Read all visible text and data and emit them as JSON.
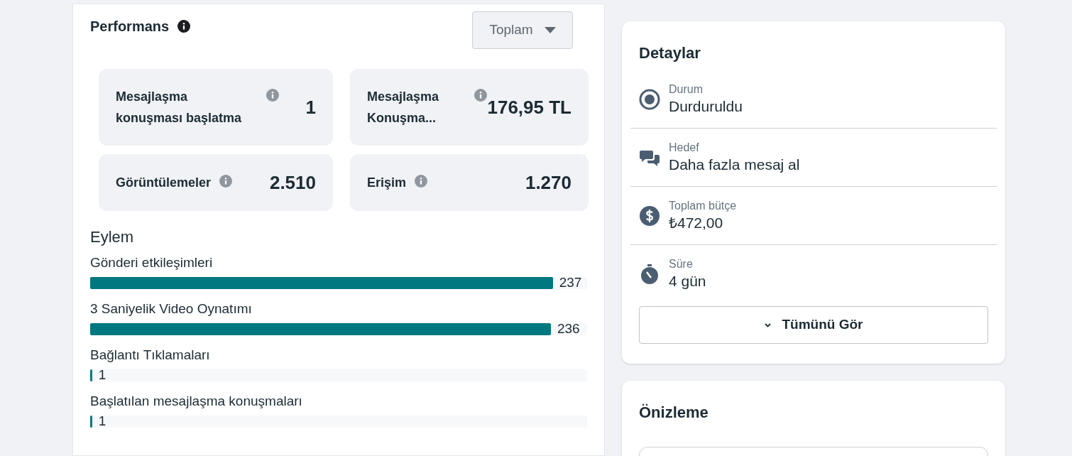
{
  "performance": {
    "title": "Performans",
    "dropdown": {
      "value": "Toplam"
    },
    "metrics": [
      {
        "label": "Mesajlaşma konuşması başlatma",
        "value": "1"
      },
      {
        "label": "Mesajlaşma Konuşma...",
        "value": "176,95 TL"
      },
      {
        "label": "Görüntülemeler",
        "value": "2.510"
      },
      {
        "label": "Erişim",
        "value": "1.270"
      }
    ],
    "actions_title": "Eylem",
    "actions": [
      {
        "label": "Gönderi etkileşimleri",
        "value": "237",
        "level": 0.931
      },
      {
        "label": "3 Saniyelik Video Oynatımı",
        "value": "236",
        "level": 0.927
      },
      {
        "label": "Bağlantı Tıklamaları",
        "value": "1",
        "level": 0.004
      },
      {
        "label": "Başlatılan mesajlaşma konuşmaları",
        "value": "1",
        "level": 0.004
      }
    ]
  },
  "details": {
    "title": "Detaylar",
    "items": [
      {
        "kind": "status",
        "label": "Durum",
        "value": "Durduruldu"
      },
      {
        "kind": "goal",
        "label": "Hedef",
        "value": "Daha fazla mesaj al"
      },
      {
        "kind": "budget",
        "label": "Toplam bütçe",
        "value": "₺472,00"
      },
      {
        "kind": "duration",
        "label": "Süre",
        "value": "4 gün"
      }
    ],
    "see_all": "Tümünü Gör"
  },
  "preview": {
    "title": "Önizleme"
  }
}
